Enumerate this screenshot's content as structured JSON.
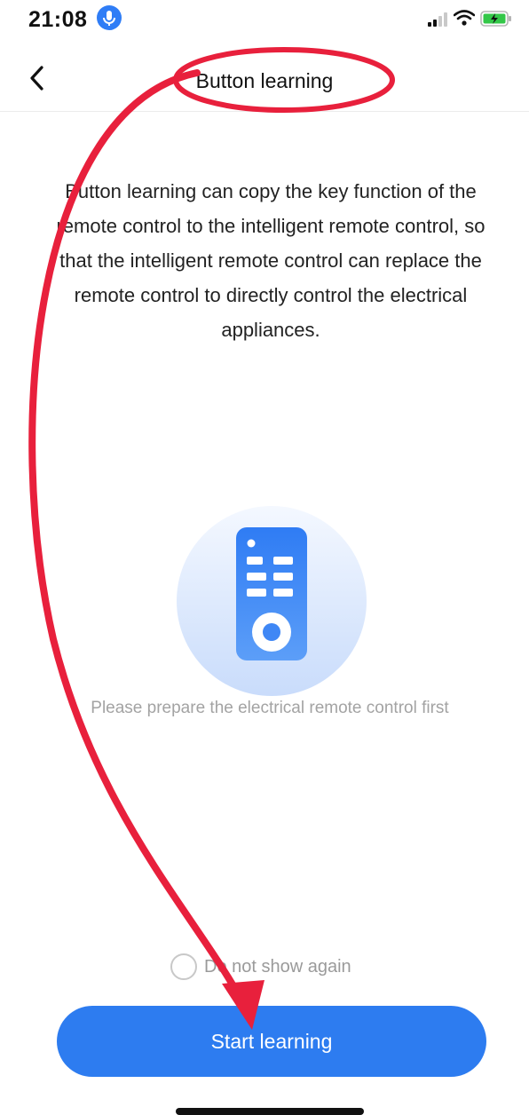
{
  "status_bar": {
    "time": "21:08",
    "icons": [
      "microphone-icon",
      "cellular-signal-icon",
      "wifi-icon",
      "battery-charging-icon"
    ]
  },
  "nav": {
    "back_icon": "chevron-left-icon",
    "title": "Button learning"
  },
  "main": {
    "description": "Button learning can copy the key function of the remote control to the intelligent remote control, so that the intelligent remote control can replace the remote control to directly control the electrical appliances.",
    "illustration_icon": "remote-control-icon",
    "hint": "Please prepare the electrical remote control first"
  },
  "footer": {
    "dont_show_label": "Do not show again",
    "dont_show_checked": false,
    "start_button_label": "Start learning"
  },
  "colors": {
    "accent": "#2d7cf0",
    "annotation": "#e8203c",
    "hint_text": "#a3a3a3"
  }
}
